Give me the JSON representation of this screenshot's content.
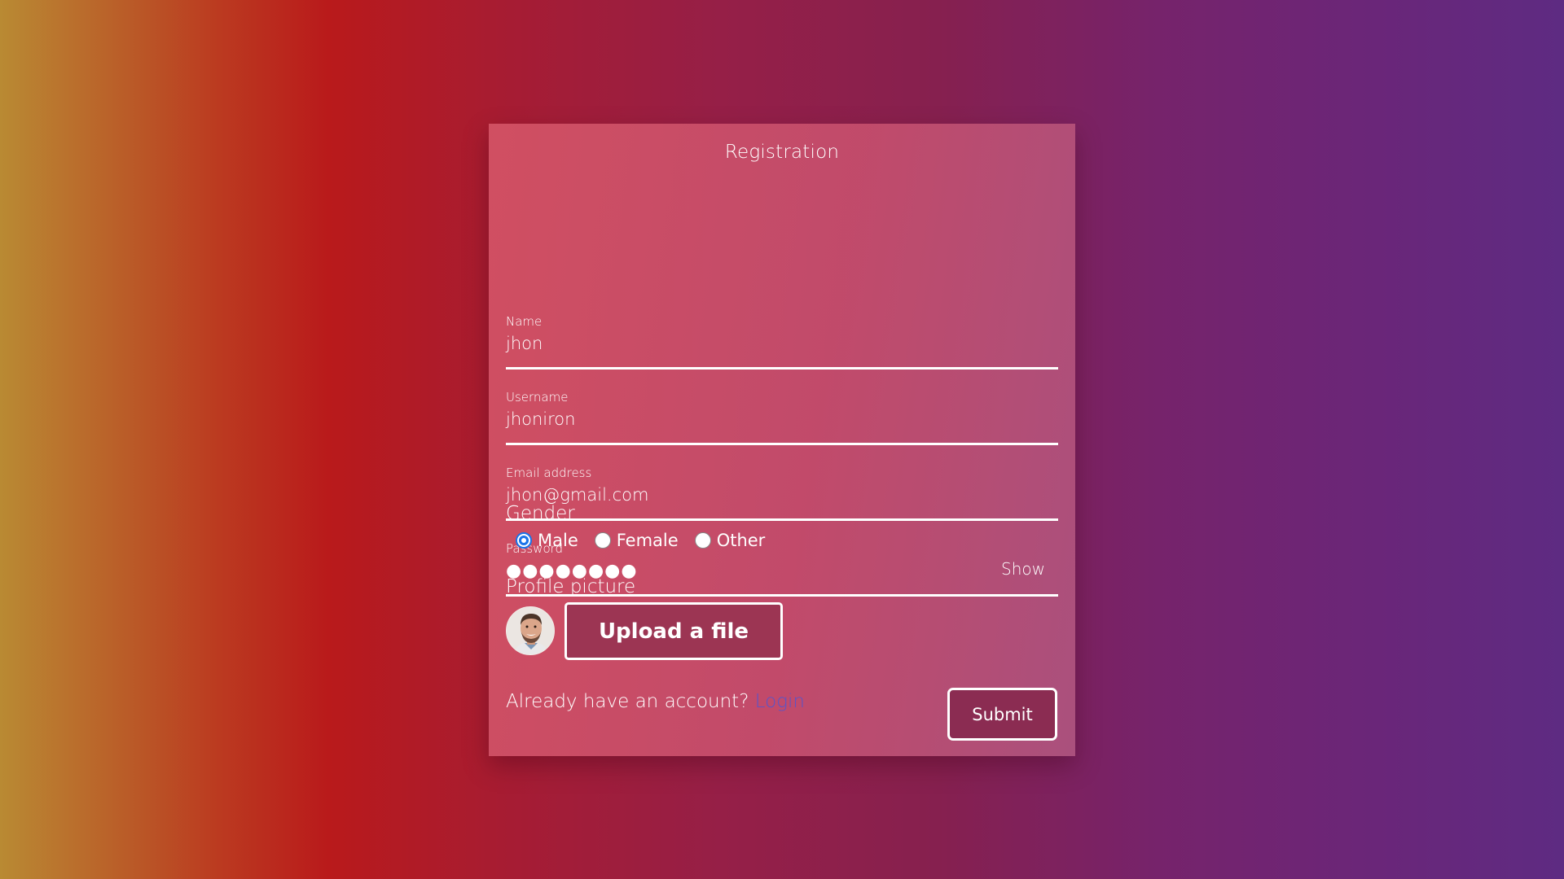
{
  "form": {
    "title": "Registration",
    "fields": [
      {
        "label": "Name",
        "value": "jhon"
      },
      {
        "label": "Username",
        "value": "jhoniron"
      },
      {
        "label": "Email address",
        "value": "jhon@gmail.com"
      },
      {
        "label": "Password",
        "value": "●●●●●●●●",
        "toggle": "Show"
      }
    ],
    "gender": {
      "title": "Gender",
      "options": [
        "Male",
        "Female",
        "Other"
      ],
      "selected": "Male"
    },
    "profile": {
      "title": "Profile picture",
      "upload_label": "Upload a file"
    },
    "footer": {
      "prompt": "Already have an account?",
      "login_label": "Login",
      "submit_label": "Submit"
    }
  }
}
